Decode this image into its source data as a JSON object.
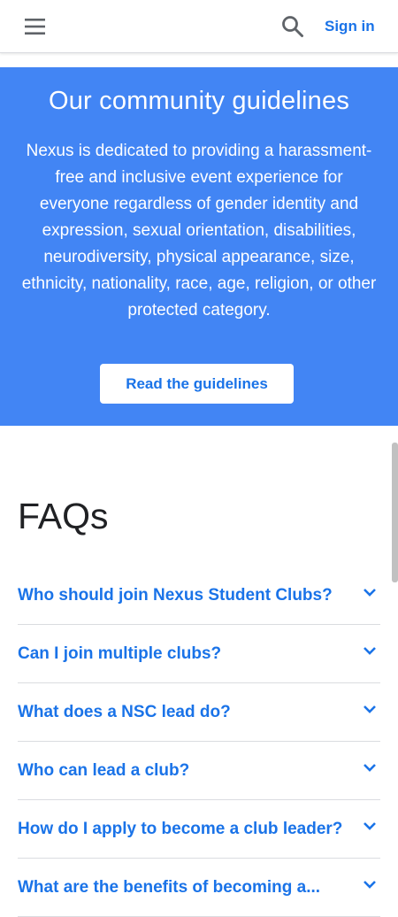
{
  "header": {
    "menu_icon": "hamburger-menu-icon",
    "search_icon": "search-icon",
    "signin_label": "Sign in"
  },
  "guidelines": {
    "title": "Our community guidelines",
    "body": "Nexus is dedicated to providing a harassment-free and inclusive event experience for everyone regardless of gender identity and expression, sexual orientation, disabilities, neurodiversity, physical appearance, size, ethnicity, nationality, race, age, religion, or other protected category.",
    "button_label": "Read the guidelines",
    "background_color": "#4285f4"
  },
  "faqs": {
    "title": "FAQs",
    "items": [
      {
        "question": "Who should join Nexus Student Clubs?"
      },
      {
        "question": "Can I join multiple clubs?"
      },
      {
        "question": "What does a NSC lead do?"
      },
      {
        "question": "Who can lead a club?"
      },
      {
        "question": "How do I apply to become a club leader?"
      },
      {
        "question": "What are the benefits of becoming a..."
      }
    ],
    "chevron_icon": "chevron-down-icon",
    "accent_color": "#1a73e8"
  }
}
